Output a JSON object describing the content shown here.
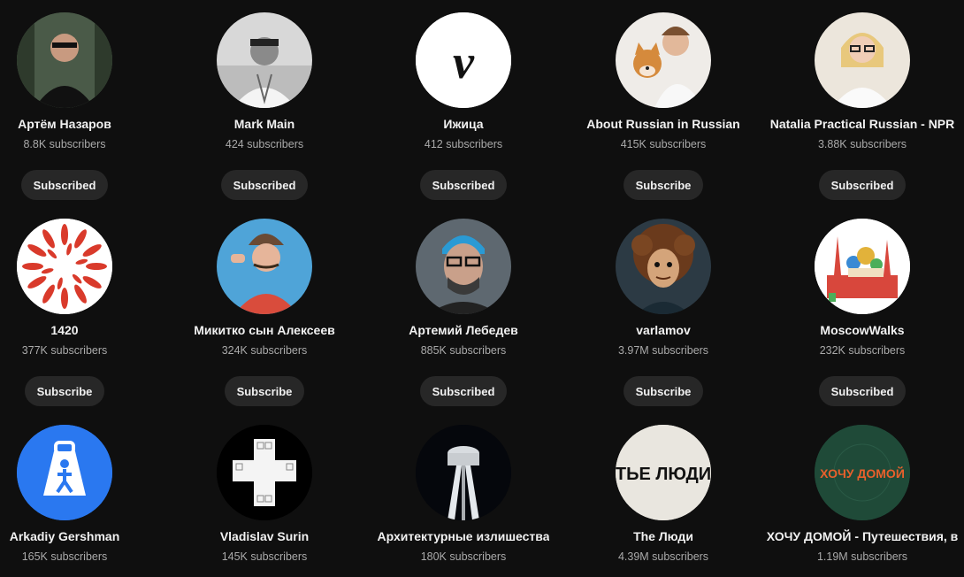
{
  "channels": [
    {
      "name": "Артём Назаров",
      "subs": "8.8K subscribers",
      "button": "Subscribed",
      "avatar": "portrait-photo-icon"
    },
    {
      "name": "Mark Main",
      "subs": "424 subscribers",
      "button": "Subscribed",
      "avatar": "portrait-photo-icon"
    },
    {
      "name": "Ижица",
      "subs": "412 subscribers",
      "button": "Subscribed",
      "avatar": "izhitsa-letter-logo"
    },
    {
      "name": "About Russian in Russian",
      "subs": "415K subscribers",
      "button": "Subscribe",
      "avatar": "portrait-with-dog-icon"
    },
    {
      "name": "Natalia Practical Russian - NPR",
      "subs": "3.88K subscribers",
      "button": "Subscribed",
      "avatar": "portrait-photo-icon"
    },
    {
      "name": "1420",
      "subs": "377K subscribers",
      "button": "Subscribe",
      "avatar": "red-petal-circle-logo"
    },
    {
      "name": "Микитко сын Алексеев",
      "subs": "324K subscribers",
      "button": "Subscribe",
      "avatar": "portrait-photo-icon"
    },
    {
      "name": "Артемий Лебедев",
      "subs": "885K subscribers",
      "button": "Subscribed",
      "avatar": "portrait-photo-icon"
    },
    {
      "name": "varlamov",
      "subs": "3.97M subscribers",
      "button": "Subscribe",
      "avatar": "cartoon-portrait-icon"
    },
    {
      "name": "MoscowWalks",
      "subs": "232K subscribers",
      "button": "Subscribed",
      "avatar": "kremlin-illustration-icon"
    },
    {
      "name": "Arkadiy Gershman",
      "subs": "165K subscribers",
      "button": "",
      "avatar": "blue-bag-person-logo"
    },
    {
      "name": "Vladislav Surin",
      "subs": "145K subscribers",
      "button": "",
      "avatar": "cross-windows-logo"
    },
    {
      "name": "Архитектурные излишества",
      "subs": "180K subscribers",
      "button": "",
      "avatar": "water-tower-icon"
    },
    {
      "name": "The Люди",
      "subs": "4.39M subscribers",
      "button": "",
      "avatar": "the-lyudi-logo"
    },
    {
      "name": "ХОЧУ ДОМОЙ - Путешествия, в",
      "subs": "1.19M subscribers",
      "button": "",
      "avatar": "khochu-domoy-logo"
    }
  ],
  "logo_text": {
    "izhitsa": "v",
    "the_lyudi": "ТЬЕ ЛЮДИ",
    "khochu": "ХОЧУ ДОМОЙ"
  },
  "colors": {
    "background": "#0f0f0f",
    "button_bg": "#272727",
    "text": "#f1f1f1",
    "subtext": "#aaaaaa"
  }
}
